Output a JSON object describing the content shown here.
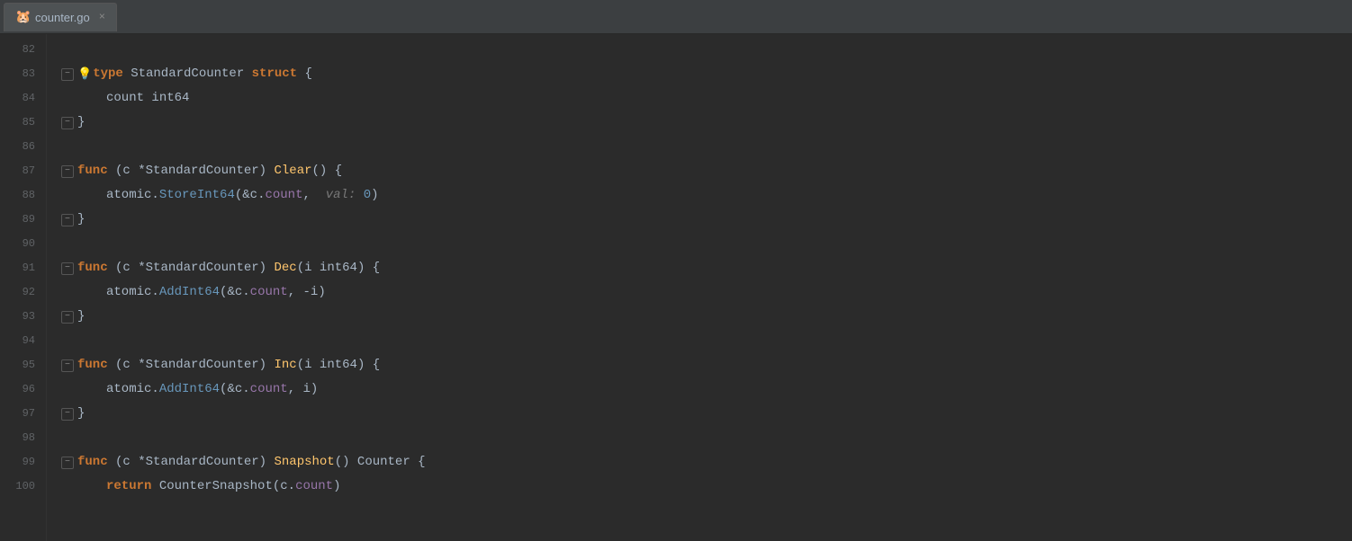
{
  "tab": {
    "icon": "🐹",
    "label": "counter.go",
    "close_label": "×"
  },
  "lines": [
    {
      "num": "82",
      "content": []
    },
    {
      "num": "83",
      "content": "type StandardCounter struct {",
      "fold": "minus",
      "bulb": true
    },
    {
      "num": "84",
      "content": "    count int64",
      "indent": 1
    },
    {
      "num": "85",
      "content": "}",
      "fold": "minus"
    },
    {
      "num": "86",
      "content": []
    },
    {
      "num": "87",
      "content": "func (c *StandardCounter) Clear() {",
      "fold": "minus"
    },
    {
      "num": "88",
      "content": "    atomic.StoreInt64(&c.count,  val: 0)",
      "indent": 1,
      "hint": true
    },
    {
      "num": "89",
      "content": "}",
      "fold": "minus"
    },
    {
      "num": "90",
      "content": []
    },
    {
      "num": "91",
      "content": "func (c *StandardCounter) Dec(i int64) {",
      "fold": "minus"
    },
    {
      "num": "92",
      "content": "    atomic.AddInt64(&c.count, -i)",
      "indent": 1
    },
    {
      "num": "93",
      "content": "}",
      "fold": "minus"
    },
    {
      "num": "94",
      "content": []
    },
    {
      "num": "95",
      "content": "func (c *StandardCounter) Inc(i int64) {",
      "fold": "minus"
    },
    {
      "num": "96",
      "content": "    atomic.AddInt64(&c.count, i)",
      "indent": 1
    },
    {
      "num": "97",
      "content": "}",
      "fold": "minus"
    },
    {
      "num": "98",
      "content": []
    },
    {
      "num": "99",
      "content": "func (c *StandardCounter) Snapshot() Counter {",
      "fold": "minus"
    },
    {
      "num": "100",
      "content": "    return CounterSnapshot(c.count)",
      "indent": 1
    }
  ]
}
